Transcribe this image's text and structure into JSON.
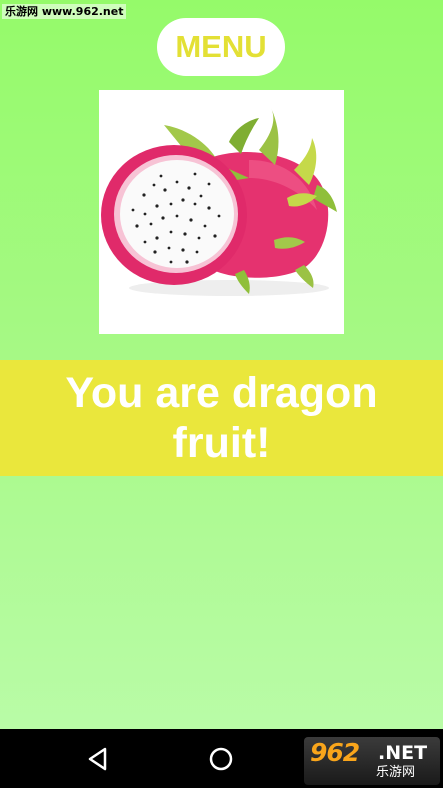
{
  "watermark": "乐游网 www.962.net",
  "menu": {
    "label": "MENU"
  },
  "result": {
    "text": "You are dragon fruit!"
  },
  "fruit_image": {
    "subject": "dragon fruit"
  },
  "navigation": {
    "back_icon": "back-triangle-icon",
    "home_icon": "home-circle-icon"
  },
  "badge": {
    "number": "962",
    "tld": ".NET",
    "subtitle": "乐游网"
  },
  "colors": {
    "background_top": "#95fa6a",
    "background_bottom": "#bcfcac",
    "accent_yellow": "#eae73c",
    "menu_text": "#e3e035",
    "nav_bar": "#000000"
  }
}
